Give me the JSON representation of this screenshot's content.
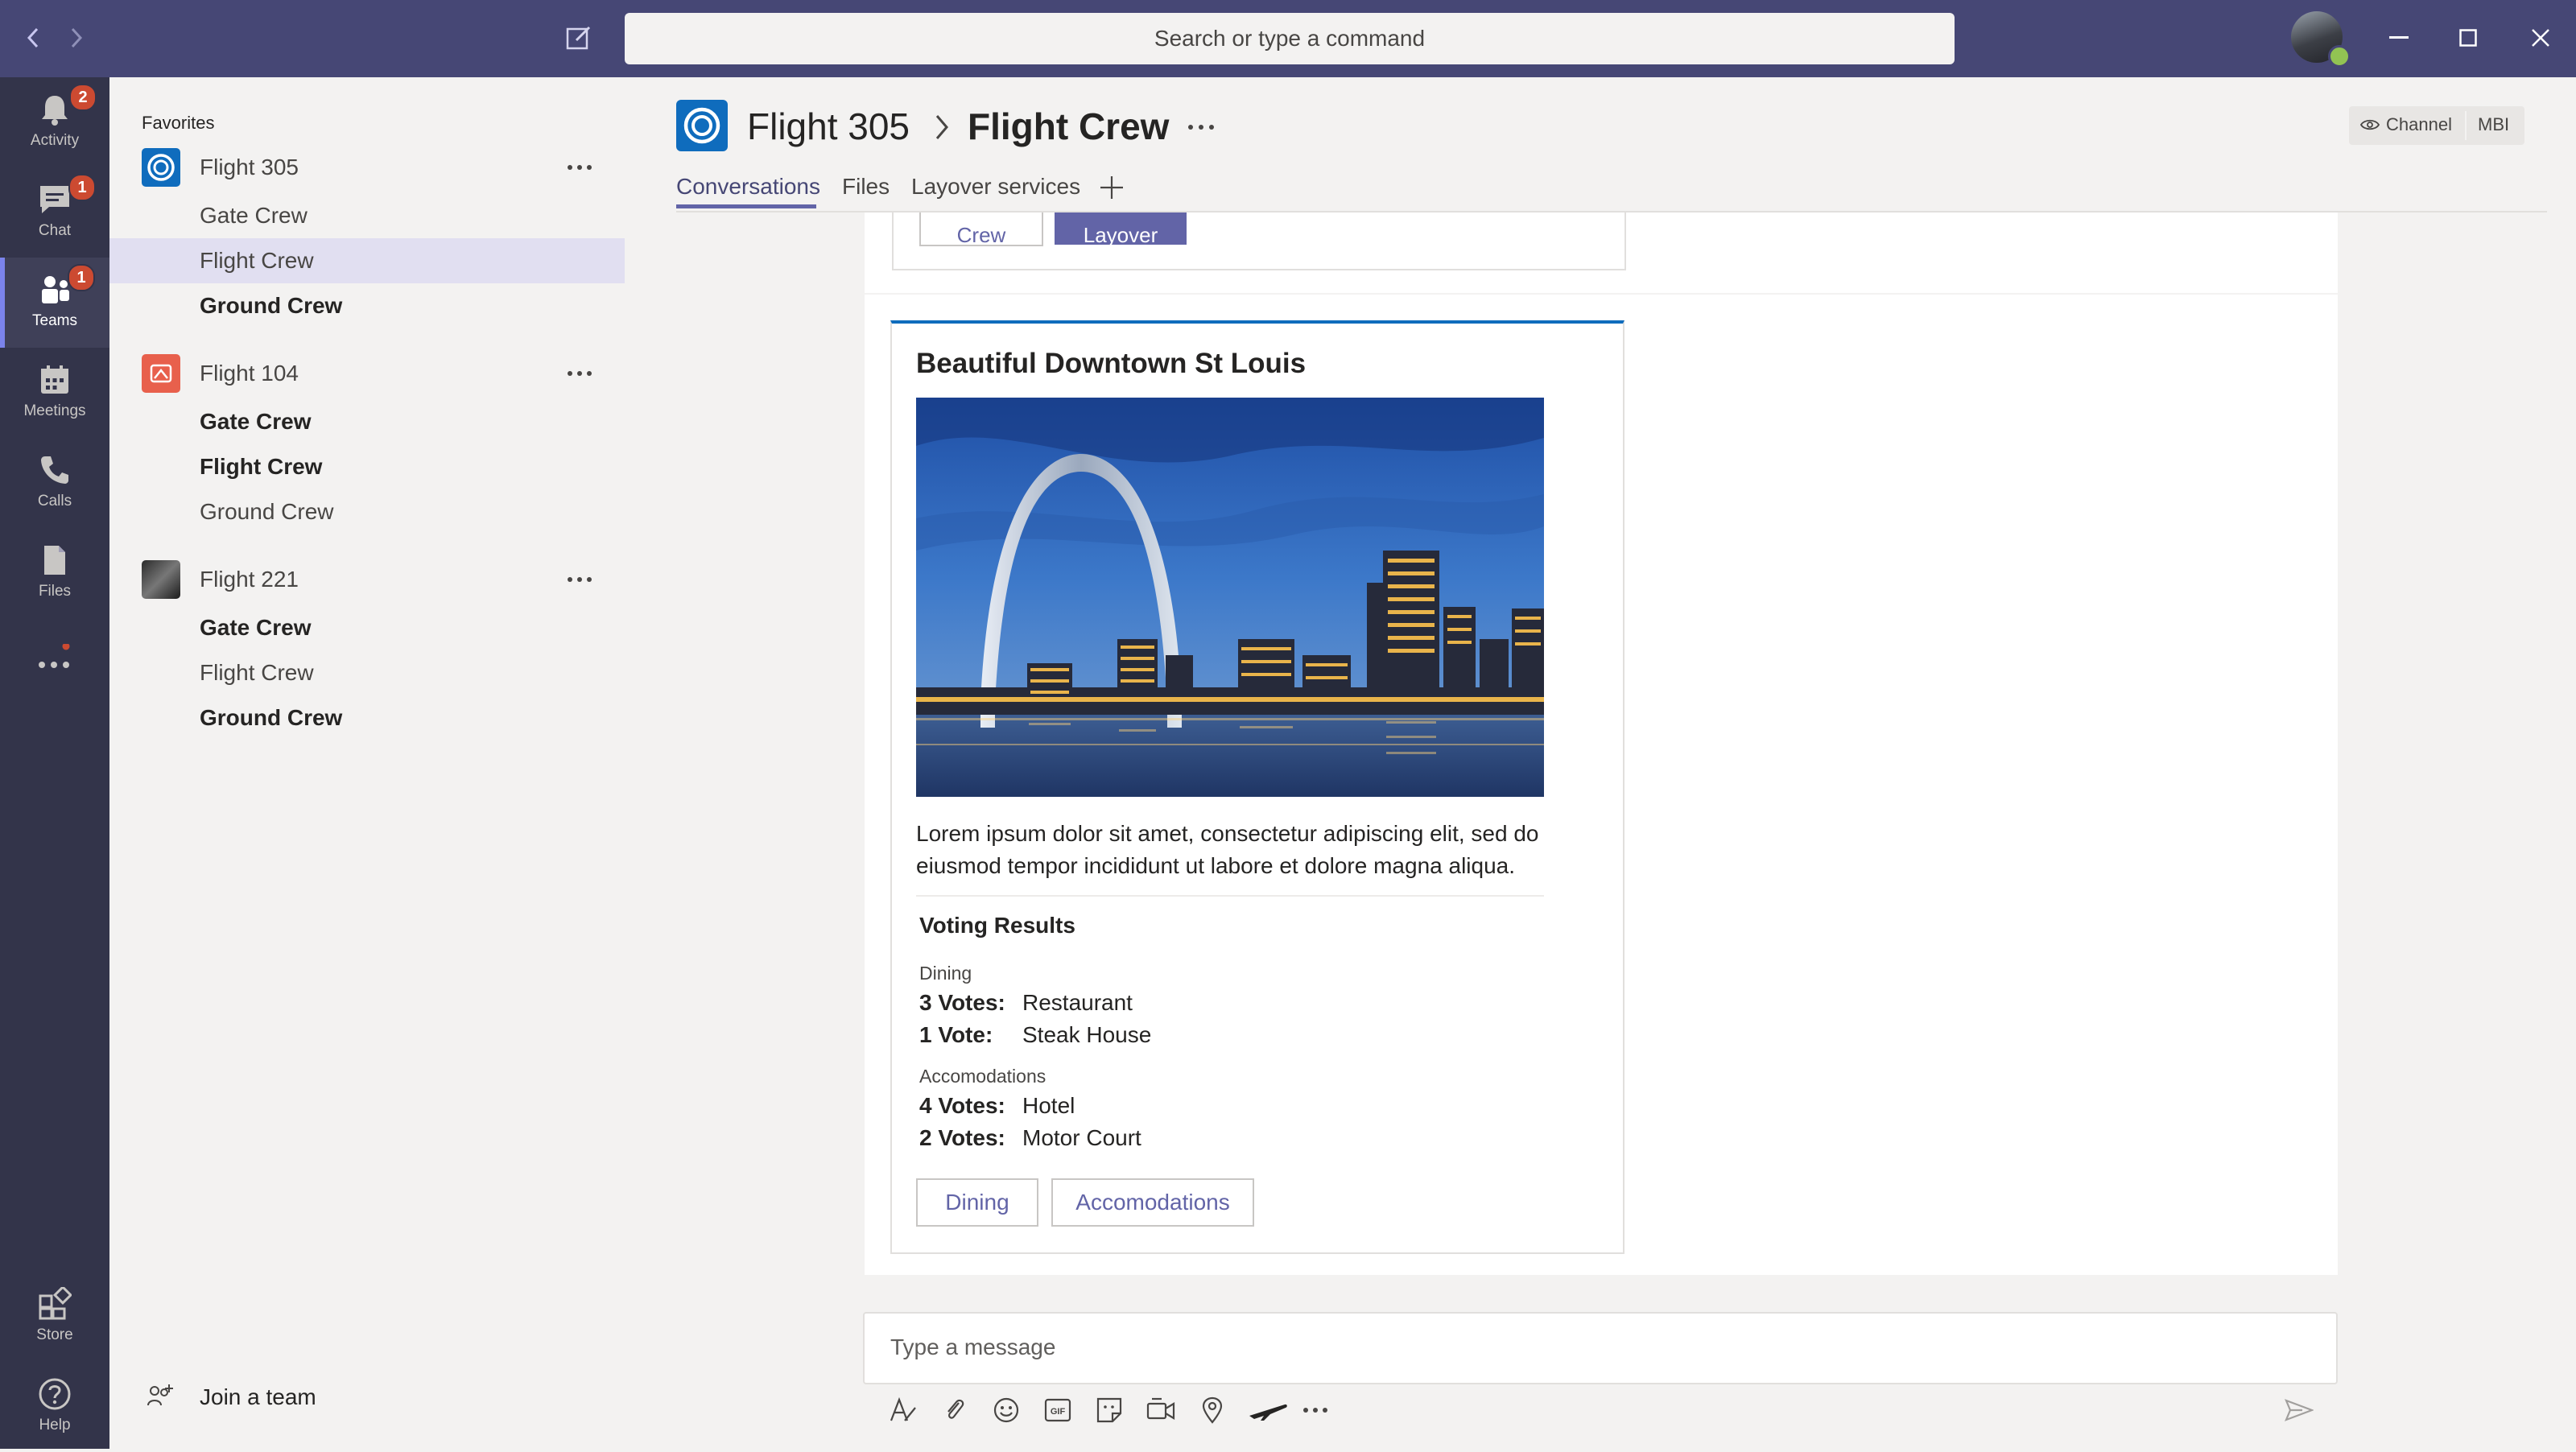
{
  "search": {
    "placeholder": "Search or type a command"
  },
  "rail": {
    "items": [
      {
        "label": "Activity",
        "badge": "2"
      },
      {
        "label": "Chat",
        "badge": "1"
      },
      {
        "label": "Teams",
        "badge": "1"
      },
      {
        "label": "Meetings"
      },
      {
        "label": "Calls"
      },
      {
        "label": "Files"
      },
      {
        "label": "Store"
      },
      {
        "label": "Help"
      }
    ]
  },
  "sidebar": {
    "favorites_label": "Favorites",
    "teams": [
      {
        "name": "Flight 305",
        "channels": [
          "Gate Crew",
          "Flight Crew",
          "Ground Crew"
        ]
      },
      {
        "name": "Flight 104",
        "channels": [
          "Gate Crew",
          "Flight Crew",
          "Ground Crew"
        ]
      },
      {
        "name": "Flight 221",
        "channels": [
          "Gate Crew",
          "Flight Crew",
          "Ground Crew"
        ]
      }
    ],
    "join_team": "Join a team"
  },
  "header": {
    "team": "Flight 305",
    "channel": "Flight Crew",
    "channel_pill": "Channel",
    "org_pill": "MBI"
  },
  "tabs": [
    {
      "label": "Conversations"
    },
    {
      "label": "Files"
    },
    {
      "label": "Layover services"
    }
  ],
  "previous_card": {
    "buttons": [
      "Crew",
      "Layover"
    ]
  },
  "card": {
    "title": "Beautiful Downtown St Louis",
    "body": "Lorem ipsum dolor sit amet, consectetur adipiscing elit, sed do eiusmod tempor incididunt ut labore et dolore magna aliqua.",
    "voting_title": "Voting Results",
    "categories": [
      {
        "label": "Dining",
        "results": [
          {
            "count": "3 Votes:",
            "option": "Restaurant"
          },
          {
            "count": "1 Vote:",
            "option": "Steak House"
          }
        ]
      },
      {
        "label": "Accomodations",
        "results": [
          {
            "count": "4 Votes:",
            "option": "Hotel"
          },
          {
            "count": "2 Votes:",
            "option": "Motor Court"
          }
        ]
      }
    ],
    "buttons": [
      "Dining",
      "Accomodations"
    ]
  },
  "compose": {
    "placeholder": "Type a message"
  },
  "colors": {
    "titlebar": "#464775",
    "rail": "#33344a",
    "accent": "#6264a7",
    "badge": "#cc4a31"
  }
}
